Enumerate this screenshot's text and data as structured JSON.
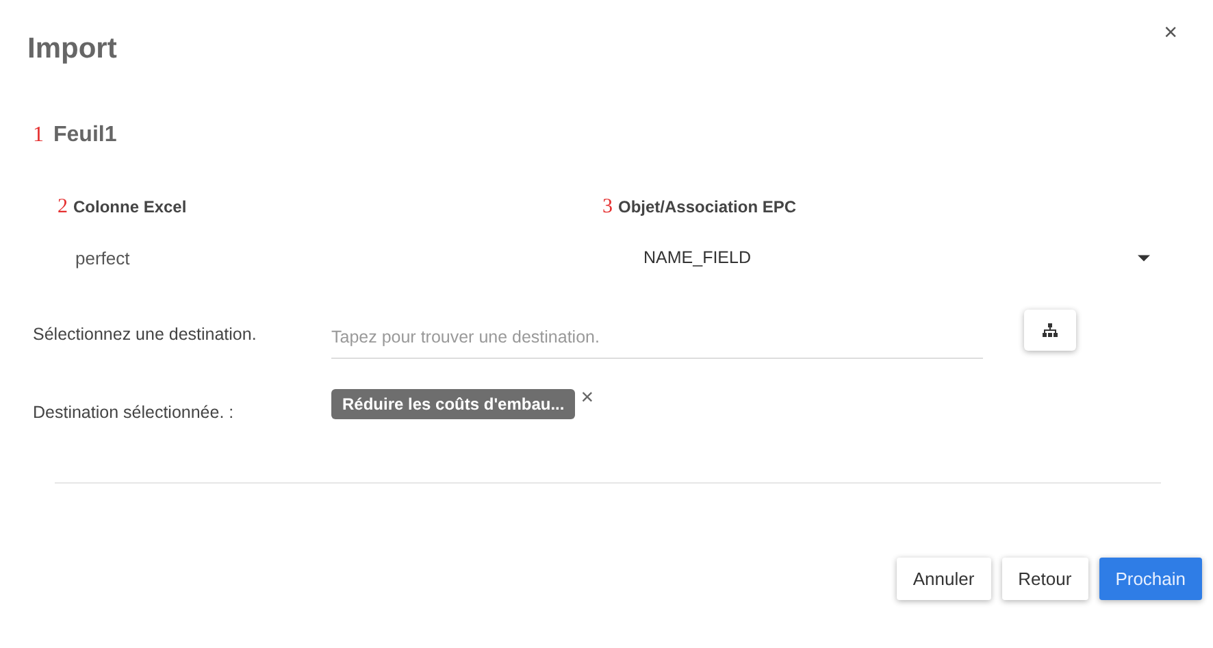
{
  "dialog": {
    "title": "Import",
    "close": "×"
  },
  "sheet": {
    "step": "1",
    "name": "Feuil1"
  },
  "columns": [
    {
      "step": "2",
      "heading": "Colonne Excel"
    },
    {
      "step": "3",
      "heading": "Objet/Association EPC"
    }
  ],
  "mapping": {
    "excel_column": "perfect",
    "epc_object": "NAME_FIELD"
  },
  "destination": {
    "label": "Sélectionnez une destination.",
    "placeholder": "Tapez pour trouver une destination."
  },
  "selected_destination": {
    "label": "Destination sélectionnée. :",
    "chip": "Réduire les coûts d'embau...",
    "remove": "×"
  },
  "buttons": [
    {
      "label": "Annuler",
      "kind": "default"
    },
    {
      "label": "Retour",
      "kind": "default"
    },
    {
      "label": "Prochain",
      "kind": "primary"
    }
  ]
}
